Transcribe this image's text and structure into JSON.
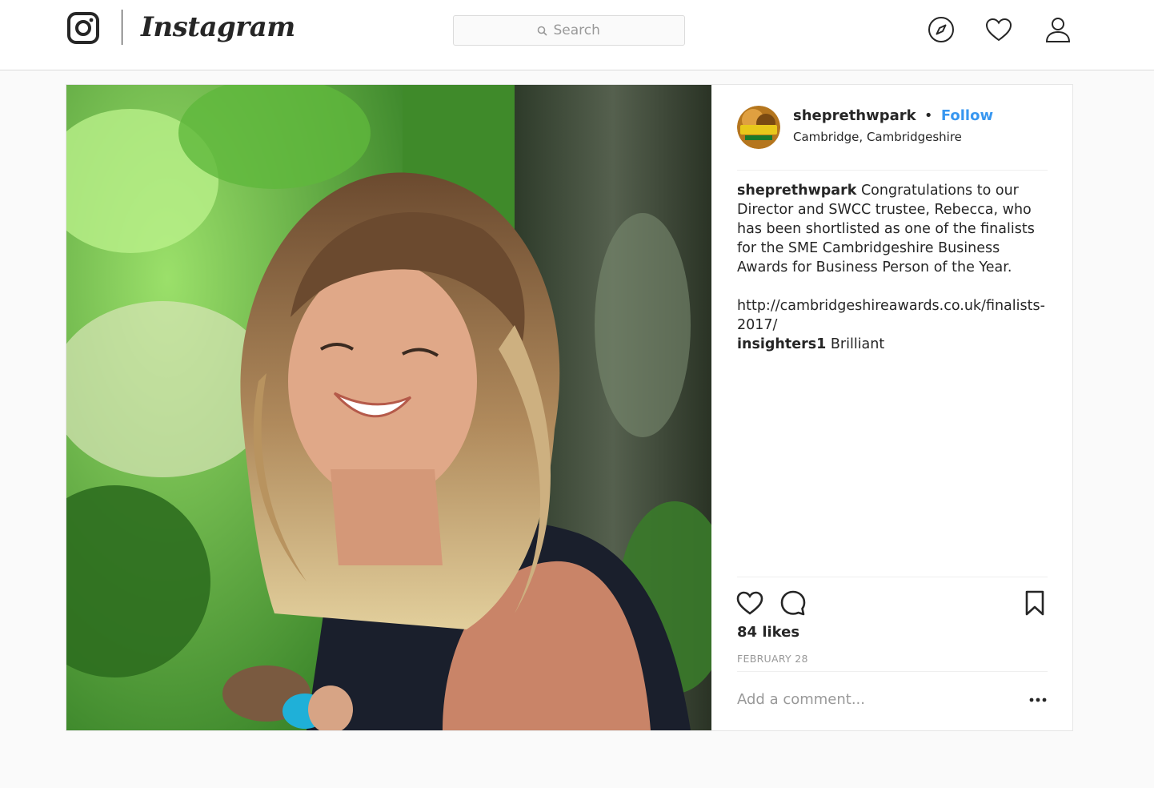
{
  "header": {
    "brand": "Instagram",
    "search_placeholder": "Search",
    "icons": [
      "instagram-glyph-icon",
      "compass-icon",
      "heart-icon",
      "person-icon"
    ]
  },
  "post": {
    "author": "sheprethwpark",
    "separator": "•",
    "follow_label": "Follow",
    "location": "Cambridge, Cambridgeshire",
    "avatar_text": "SHEPRETH",
    "caption_user": "sheprethwpark",
    "caption_text": "Congratulations to our Director and SWCC trustee, Rebecca, who has been shortlisted as one of the finalists for the SME Cambridgeshire Business Awards for Business Person of the Year.",
    "caption_link": "http://cambridgeshireawards.co.uk/finalists-2017/",
    "comments": [
      {
        "user": "insighters1",
        "text": "Brilliant"
      }
    ],
    "likes": "84 likes",
    "date": "FEBRUARY 28",
    "add_comment_placeholder": "Add a comment...",
    "action_icons": [
      "heart-icon",
      "comment-bubble-icon",
      "bookmark-icon",
      "more-options-icon"
    ]
  },
  "colors": {
    "link_blue": "#3897f0",
    "text": "#262626",
    "muted": "#999999",
    "border": "#dbdbdb",
    "page_bg": "#fafafa"
  }
}
